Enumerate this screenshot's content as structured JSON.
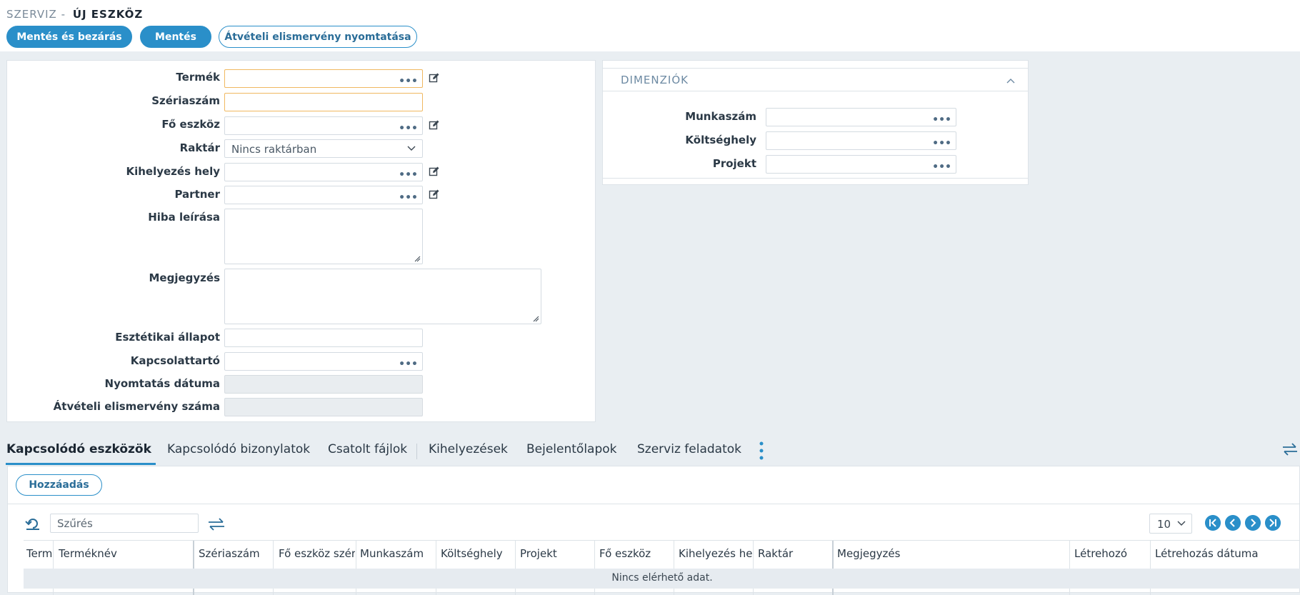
{
  "breadcrumb": {
    "section": "SZERVIZ -",
    "page": "ÚJ ESZKÖZ"
  },
  "toolbar": {
    "save_close": "Mentés és bezárás",
    "save": "Mentés",
    "print_receipt": "Átvételi elismervény nyomtatása"
  },
  "form": {
    "termek": "Termék",
    "szeriaszam": "Szériaszám",
    "fo_eszkoz": "Fő eszköz",
    "raktar": "Raktár",
    "raktar_value": "Nincs raktárban",
    "kihelyezes_hely": "Kihelyezés hely",
    "partner": "Partner",
    "hiba_leirasa": "Hiba leírása",
    "megjegyzes": "Megjegyzés",
    "esztetikai_allapot": "Esztétikai állapot",
    "kapcsolattarto": "Kapcsolattartó",
    "nyomtatas_datuma": "Nyomtatás dátuma",
    "atveteli_szam": "Átvételi elismervény száma",
    "lookup_dots": "•••"
  },
  "dimensions": {
    "title": "DIMENZIÓK",
    "munkaszam": "Munkaszám",
    "koltseghely": "Költséghely",
    "projekt": "Projekt"
  },
  "tabs": [
    {
      "label": "Kapcsolódó eszközök"
    },
    {
      "label": "Kapcsolódó bizonylatok"
    },
    {
      "label": "Csatolt fájlok"
    },
    {
      "label": "Kihelyezések"
    },
    {
      "label": "Bejelentőlapok"
    },
    {
      "label": "Szerviz feladatok"
    }
  ],
  "grid": {
    "add_button": "Hozzáadás",
    "filter_placeholder": "Szűrés",
    "page_size": "10",
    "columns": [
      "Termé",
      "Terméknév",
      "Szériaszám",
      "Fő eszköz széri",
      "Munkaszám",
      "Költséghely",
      "Projekt",
      "Fő eszköz",
      "Kihelyezés hely",
      "Raktár",
      "Megjegyzés",
      "Létrehozó",
      "Létrehozás dátuma"
    ],
    "empty_text": "Nincs elérhető adat."
  },
  "colors": {
    "accent": "#2a8fc9",
    "focus_border": "#f0b860",
    "background": "#e9eef2"
  }
}
